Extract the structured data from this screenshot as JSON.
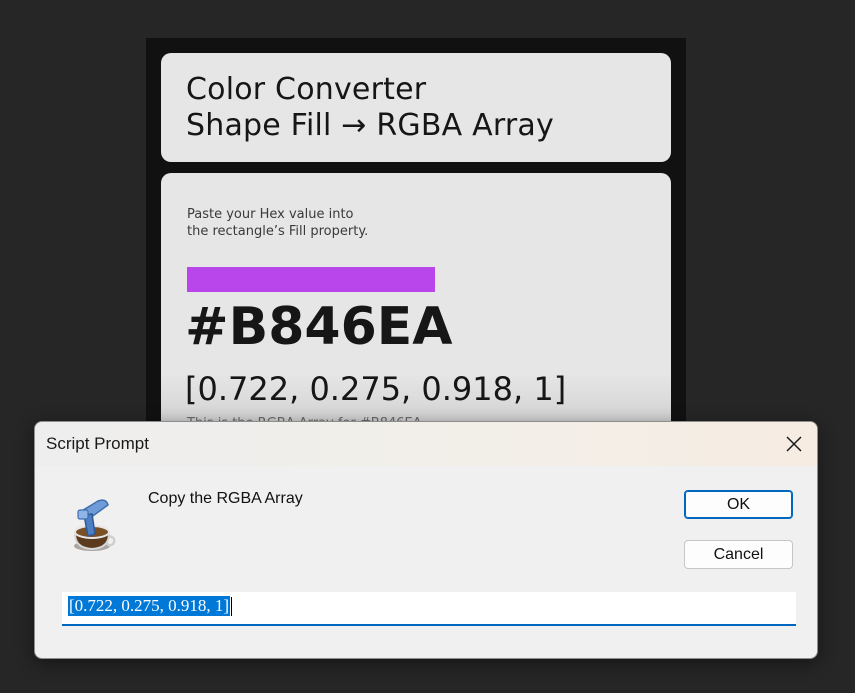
{
  "artboard": {
    "title": {
      "line1": "Color Converter",
      "line2": "Shape Fill → RGBA Array"
    },
    "instruction": {
      "line1": "Paste your Hex value into",
      "line2": "the rectangle’s Fill property."
    },
    "swatch_color": "#B846EA",
    "hex_value": "#B846EA",
    "rgba_value": "[0.722, 0.275, 0.918, 1]",
    "caption_partial": "This is the RGBA Array for #B846EA"
  },
  "dialog": {
    "title": "Script Prompt",
    "message": "Copy the RGBA Array",
    "ok_label": "OK",
    "cancel_label": "Cancel",
    "input_value": "[0.722, 0.275, 0.918, 1]",
    "icons": {
      "app": "script-icon",
      "close": "close-icon"
    },
    "accent_color": "#0067C0"
  }
}
